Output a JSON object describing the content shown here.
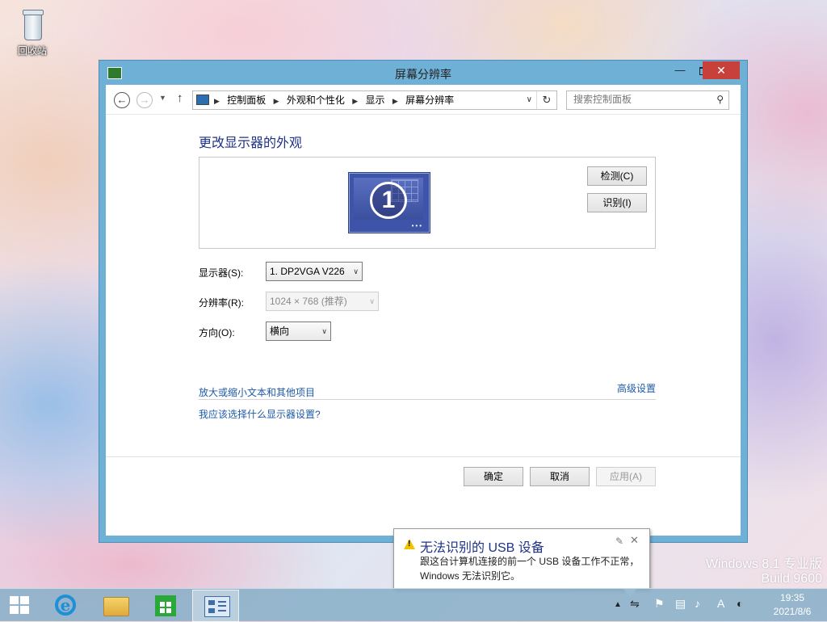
{
  "desktop": {
    "recycle_bin_label": "回收站",
    "watermark_line1": "Windows 8.1 专业版",
    "watermark_line2": "Build 9600"
  },
  "window": {
    "title": "屏幕分辨率",
    "controls": {
      "minimize": "—",
      "close": "✕"
    }
  },
  "address_bar": {
    "breadcrumbs": [
      "控制面板",
      "外观和个性化",
      "显示",
      "屏幕分辨率"
    ],
    "search_placeholder": "搜索控制面板"
  },
  "main": {
    "heading": "更改显示器的外观",
    "monitor_number": "1",
    "detect_button": "检测(C)",
    "identify_button": "识别(I)",
    "display_label": "显示器(S):",
    "display_value": "1. DP2VGA V226",
    "resolution_label": "分辨率(R):",
    "resolution_value": "1024 × 768 (推荐)",
    "orientation_label": "方向(O):",
    "orientation_value": "横向",
    "advanced_link": "高级设置",
    "link_text_size": "放大或缩小文本和其他项目",
    "link_which_settings": "我应该选择什么显示器设置?",
    "ok_button": "确定",
    "cancel_button": "取消",
    "apply_button": "应用(A)"
  },
  "notification": {
    "title": "无法识别的 USB 设备",
    "line1": "跟这台计算机连接的前一个 USB 设备工作不正常，",
    "line2": "Windows 无法识别它。"
  },
  "taskbar": {
    "apps": [
      "internet-explorer",
      "file-explorer",
      "windows-store",
      "control-panel"
    ],
    "ime_label": "A",
    "time": "19:35",
    "date": "2021/8/6"
  }
}
